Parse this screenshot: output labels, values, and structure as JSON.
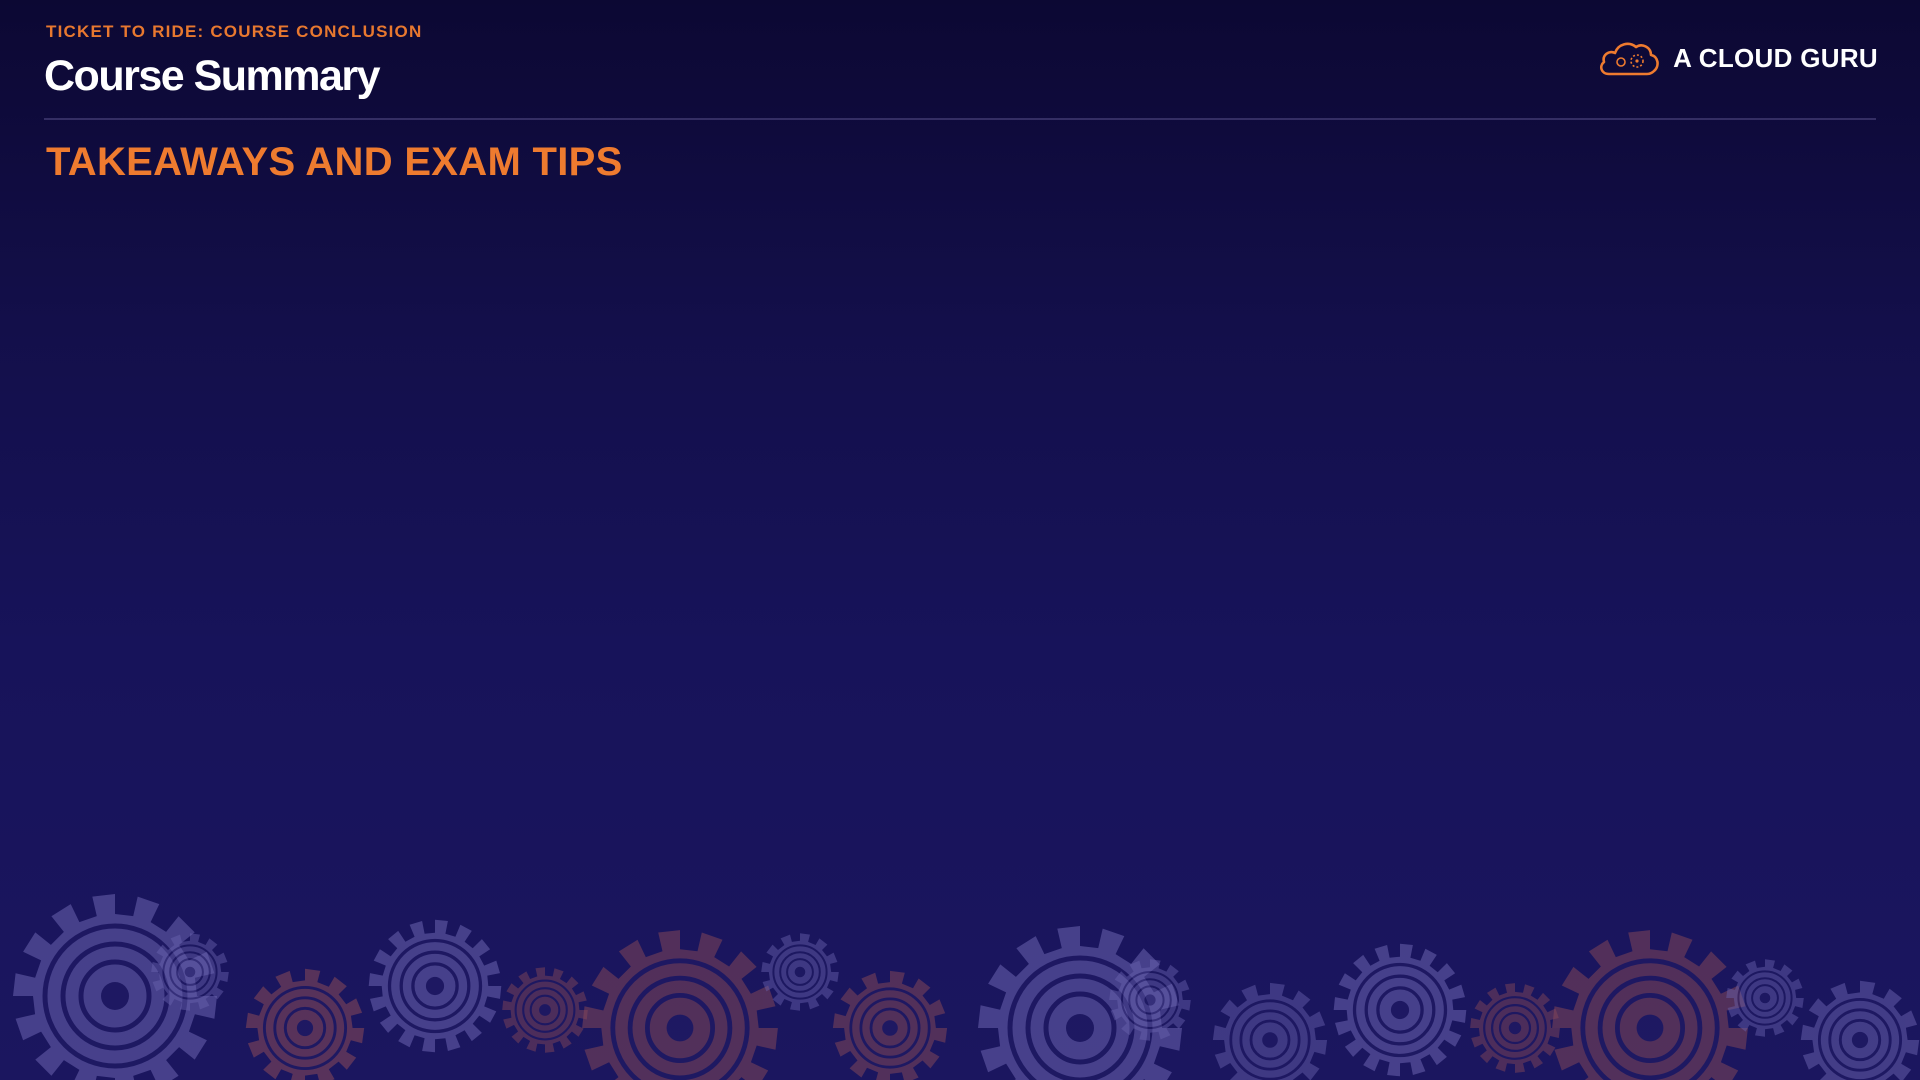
{
  "header": {
    "eyebrow": "TICKET TO RIDE: COURSE CONCLUSION",
    "title": "Course Summary"
  },
  "brand": {
    "name": "A CLOUD GURU",
    "icon": "cloud-logo-icon",
    "accent_color": "#ee7b2f"
  },
  "content": {
    "section_heading": "TAKEAWAYS AND EXAM TIPS"
  },
  "decoration": {
    "icon": "gear-pattern-icon"
  },
  "colors": {
    "background_top": "#0c0833",
    "background_bottom": "#1b165f",
    "accent": "#ee7b2f",
    "text": "#ffffff"
  }
}
